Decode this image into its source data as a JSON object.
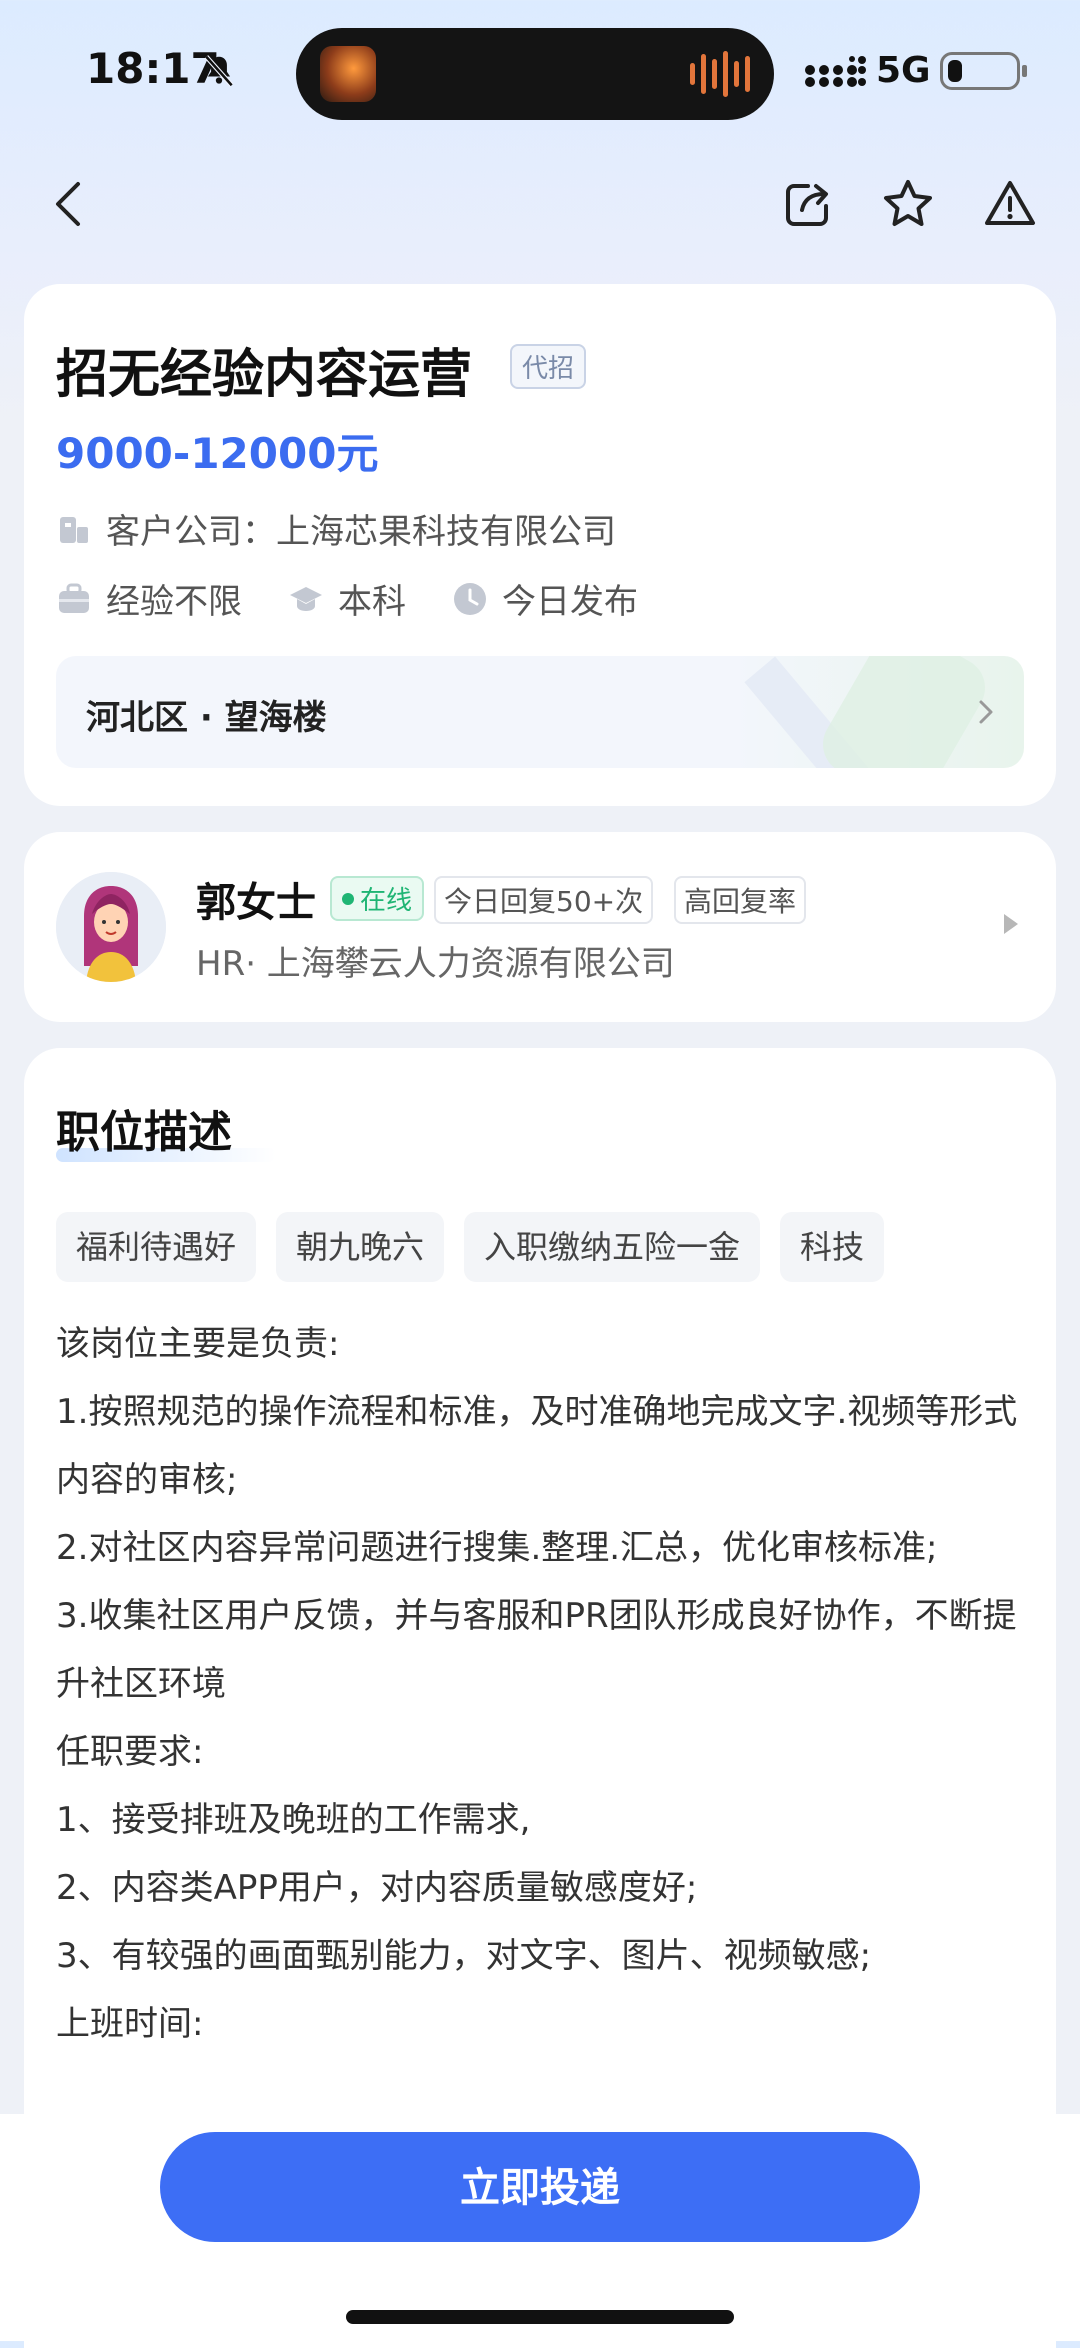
{
  "status_bar": {
    "time": "18:17",
    "network": "5G"
  },
  "job": {
    "title": "招无经验内容运营",
    "agency_tag": "代招",
    "salary": "9000-12000元",
    "client_company": "客户公司：上海芯果科技有限公司",
    "experience": "经验不限",
    "education": "本科",
    "posted": "今日发布",
    "location": "河北区 · 望海楼"
  },
  "recruiter": {
    "name": "郭女士",
    "online": "在线",
    "reply_count": "今日回复50+次",
    "reply_rate": "高回复率",
    "company": "HR· 上海攀云人力资源有限公司"
  },
  "description": {
    "title": "职位描述",
    "benefits": [
      "福利待遇好",
      "朝九晚六",
      "入职缴纳五险一金",
      "科技"
    ],
    "lines": [
      "该岗位主要是负责:",
      "1.按照规范的操作流程和标准，及时准确地完成文字.视频等形式内容的审核;",
      "2.对社区内容异常问题进行搜集.整理.汇总，优化审核标准;",
      "3.收集社区用户反馈，并与客服和PR团队形成良好协作，不断提升社区环境",
      "任职要求:",
      "1、接受排班及晚班的工作需求,",
      "2、内容类APP用户，对内容质量敏感度好;",
      "3、有较强的画面甄别能力，对文字、图片、视频敏感;",
      "上班时间:"
    ]
  },
  "actions": {
    "apply": "立即投递"
  },
  "colors": {
    "accent": "#3d6ef5",
    "salary": "#3b6cf0",
    "online": "#1fb574"
  }
}
